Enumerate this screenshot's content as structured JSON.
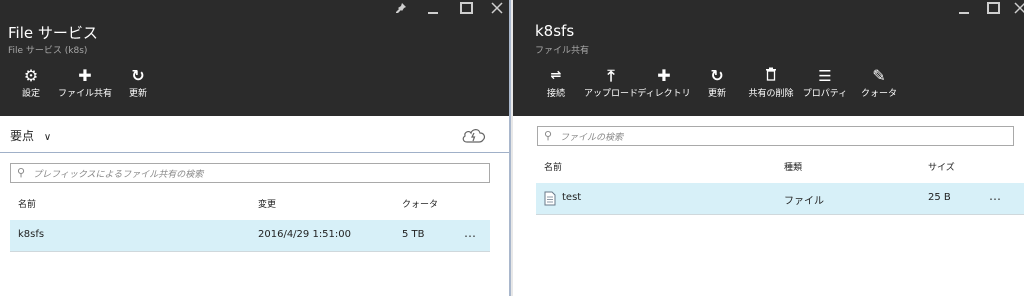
{
  "left_blade": {
    "title": "File サービス",
    "subtitle": "File サービス (k8s)",
    "window_controls": [
      "pin",
      "minimize",
      "maximize",
      "close"
    ],
    "commands": [
      {
        "label": "設定",
        "icon": "gear-icon"
      },
      {
        "label": "ファイル共有",
        "icon": "plus-icon"
      },
      {
        "label": "更新",
        "icon": "refresh-icon"
      }
    ],
    "essentials_label": "要点",
    "search_placeholder": "プレフィックスによるファイル共有の検索",
    "columns": [
      "名前",
      "変更",
      "クォータ"
    ],
    "rows": [
      {
        "name": "k8sfs",
        "modified": "2016/4/29 1:51:00",
        "quota": "5 TB",
        "more": "…"
      }
    ]
  },
  "right_blade": {
    "title": "k8sfs",
    "subtitle": "ファイル共有",
    "window_controls": [
      "minimize",
      "maximize",
      "close"
    ],
    "commands": [
      {
        "label": "接続",
        "icon": "connect-icon"
      },
      {
        "label": "アップロード",
        "icon": "upload-icon"
      },
      {
        "label": "ディレクトリ",
        "icon": "plus-icon"
      },
      {
        "label": "更新",
        "icon": "refresh-icon"
      },
      {
        "label": "共有の削除",
        "icon": "trash-icon"
      },
      {
        "label": "プロパティ",
        "icon": "list-icon"
      },
      {
        "label": "クォータ",
        "icon": "pencil-icon"
      }
    ],
    "search_placeholder": "ファイルの検索",
    "columns": [
      "名前",
      "種類",
      "サイズ"
    ],
    "rows": [
      {
        "name": "test",
        "type": "ファイル",
        "size": "25 B",
        "more": "…"
      }
    ]
  },
  "colors": {
    "header_bg": "#2b2b2b",
    "selected_row": "#d7f0f8",
    "subtitle": "#a8a8a8"
  }
}
